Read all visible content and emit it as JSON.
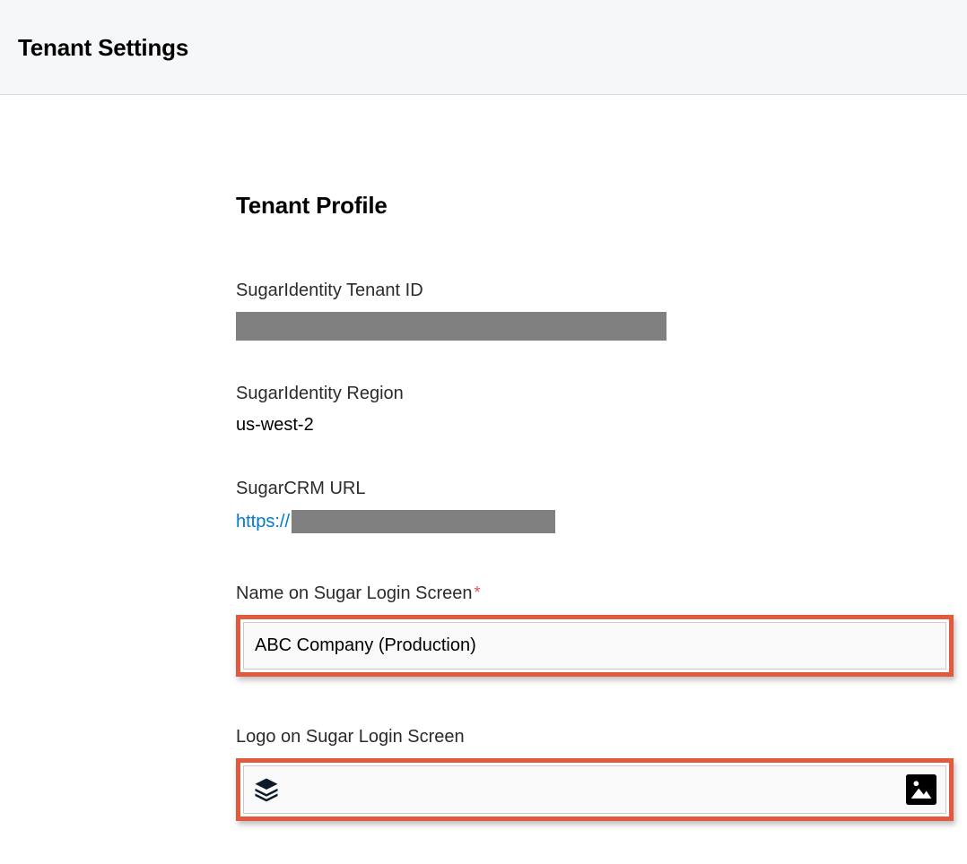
{
  "header": {
    "title": "Tenant Settings"
  },
  "profile": {
    "section_title": "Tenant Profile",
    "tenant_id": {
      "label": "SugarIdentity Tenant ID",
      "value_redacted": true
    },
    "region": {
      "label": "SugarIdentity Region",
      "value": "us-west-2"
    },
    "crm_url": {
      "label": "SugarCRM URL",
      "prefix": "https://",
      "host_redacted": true
    },
    "login_name": {
      "label": "Name on Sugar Login Screen",
      "required_marker": "*",
      "value": "ABC Company (Production)"
    },
    "login_logo": {
      "label": "Logo on Sugar Login Screen"
    }
  }
}
